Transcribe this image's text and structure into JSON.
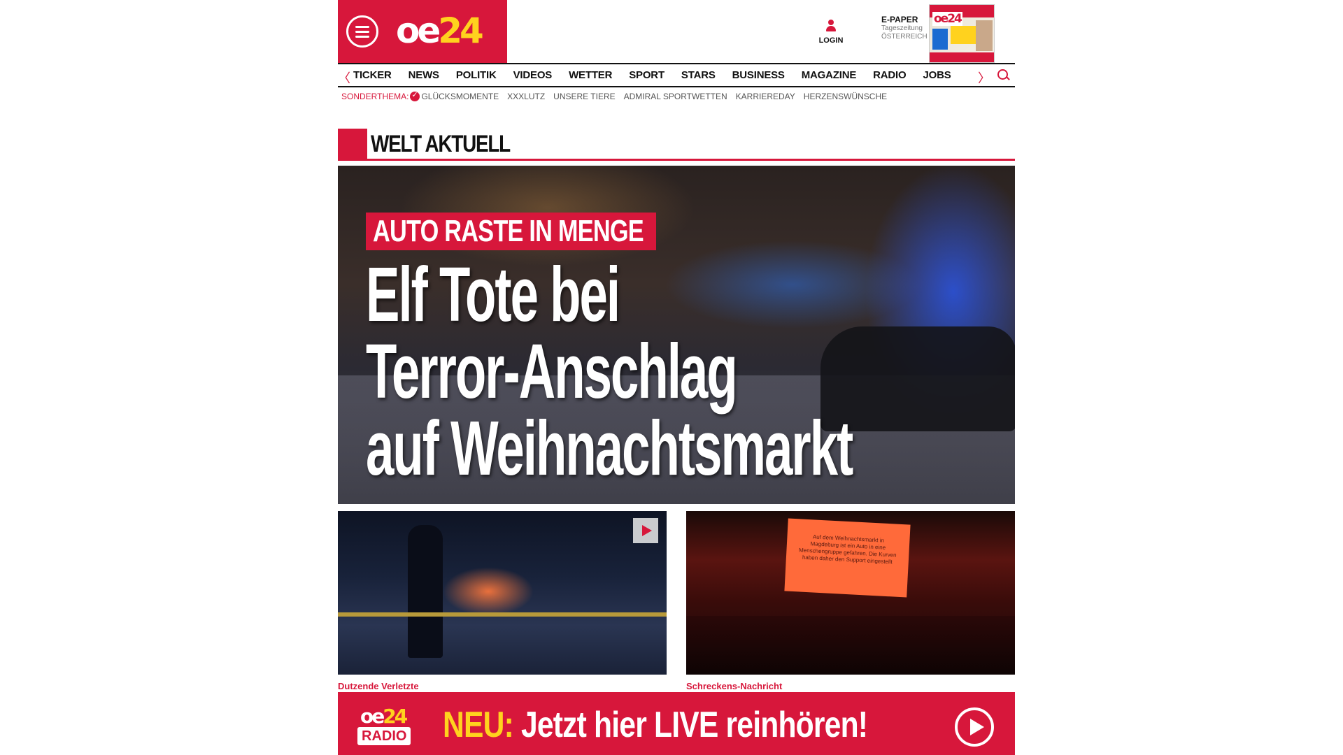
{
  "header": {
    "logo_white": "oe",
    "logo_yellow": "24",
    "login_label": "LOGIN",
    "epaper_title": "E-PAPER",
    "epaper_line1": "Tageszeitung",
    "epaper_line2": "ÖSTERREICH"
  },
  "nav": {
    "items": [
      "TICKER",
      "NEWS",
      "POLITIK",
      "VIDEOS",
      "WETTER",
      "SPORT",
      "STARS",
      "BUSINESS",
      "MAGAZINE",
      "RADIO",
      "JOBS"
    ],
    "prev_icon": "chevron-left-icon",
    "next_icon": "chevron-right-icon",
    "search_icon": "search-icon"
  },
  "subnav": {
    "lead": "SONDERTHEMA:",
    "items": [
      "GLÜCKSMOMENTE",
      "XXXLUTZ",
      "UNSERE TIERE",
      "ADMIRAL SPORTWETTEN",
      "KARRIEREDAY",
      "HERZENSWÜNSCHE"
    ]
  },
  "section": {
    "title": "WELT AKTUELL"
  },
  "hero": {
    "kicker": "AUTO RASTE IN MENGE",
    "headline_lines": [
      "Elf Tote bei",
      "Terror-Anschlag",
      "auf Weihnachtsmarkt"
    ]
  },
  "teasers": [
    {
      "caption": "Dutzende Verletzte",
      "has_video": true
    },
    {
      "caption": "Schreckens-Nachricht",
      "screen_text": "Auf dem Weihnachtsmarkt in Magdeburg ist ein Auto in eine Menschengruppe gefahren. Die Kurven haben daher den Support eingestellt"
    }
  ],
  "radio_banner": {
    "logo_top_white": "oe",
    "logo_top_yellow": "24",
    "logo_bottom": "RADIO",
    "neu": "NEU:",
    "text": "Jetzt hier LIVE reinhören!"
  },
  "colors": {
    "brand_red": "#d7173b",
    "brand_yellow": "#ffd21e"
  }
}
